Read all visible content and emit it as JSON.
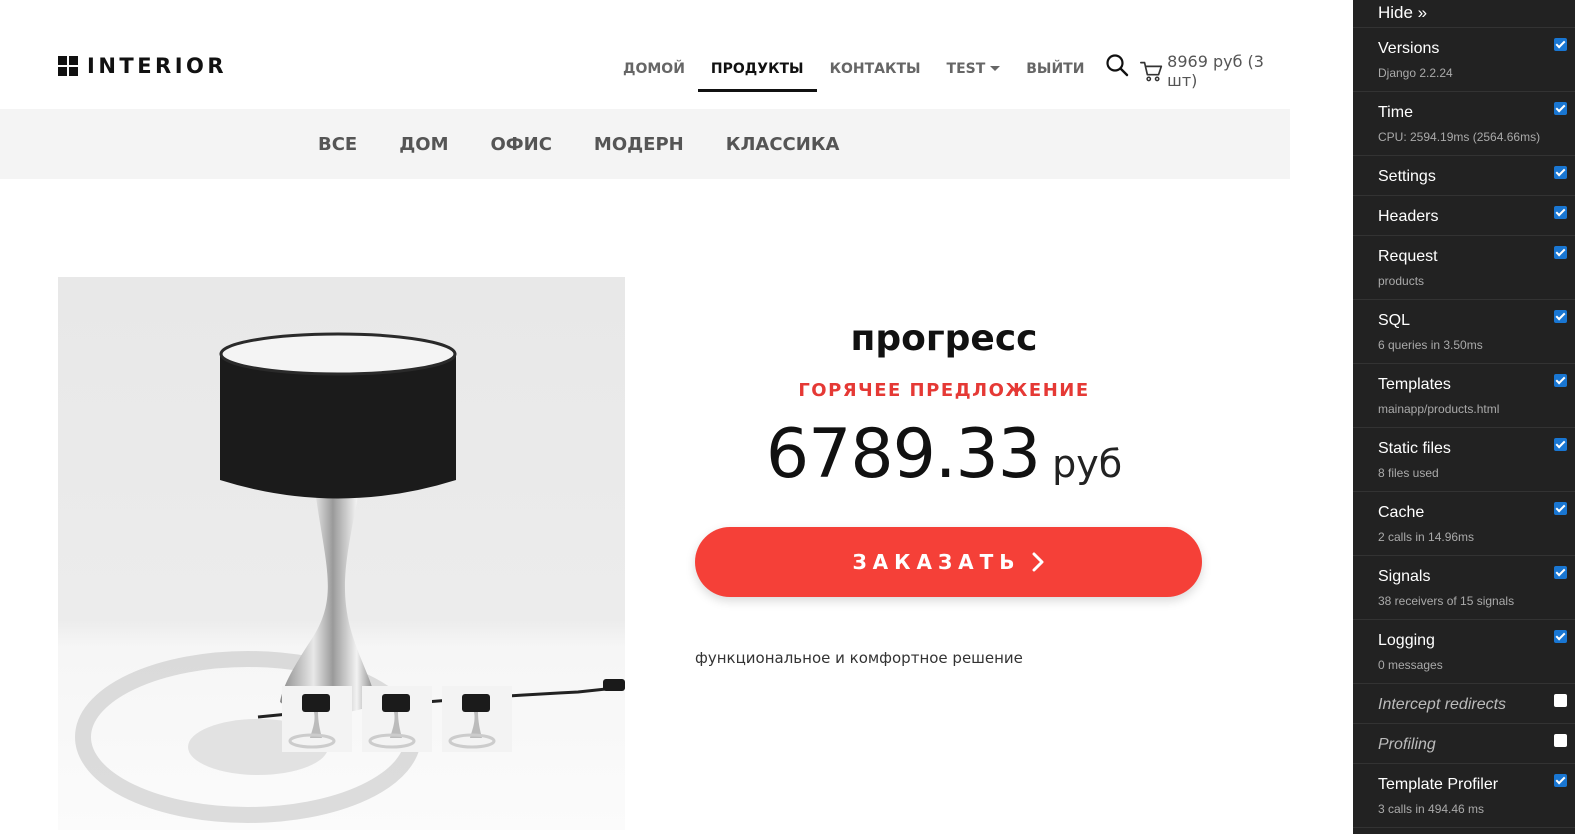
{
  "header": {
    "logo_text": "INTERIOR",
    "nav": [
      {
        "label": "ДОМОЙ"
      },
      {
        "label": "ПРОДУКТЫ"
      },
      {
        "label": "КОНТАКТЫ"
      },
      {
        "label": "TEST"
      },
      {
        "label": "ВЫЙТИ"
      }
    ],
    "active_nav": "ПРОДУКТЫ",
    "cart_text": "8969 руб (3 шт)"
  },
  "categories": [
    "ВСЕ",
    "ДОМ",
    "ОФИС",
    "МОДЕРН",
    "КЛАССИКА"
  ],
  "product": {
    "title": "прогресс",
    "offer": "ГОРЯЧЕЕ ПРЕДЛОЖЕНИЕ",
    "price": "6789.33",
    "currency": "руб",
    "order_label": "ЗАКАЗАТЬ",
    "description": "функциональное и комфортное решение",
    "thumbnail_count": 3
  },
  "colors": {
    "accent_red": "#f54038",
    "offer_red": "#e53935",
    "toolbar_bg": "#222222",
    "checkbox_blue": "#1976d2"
  },
  "debug_toolbar": {
    "hide_label": "Hide »",
    "panels": [
      {
        "title": "Versions",
        "subtitle": "Django 2.2.24",
        "checked": true
      },
      {
        "title": "Time",
        "subtitle": "CPU: 2594.19ms (2564.66ms)",
        "checked": true
      },
      {
        "title": "Settings",
        "subtitle": "",
        "checked": true
      },
      {
        "title": "Headers",
        "subtitle": "",
        "checked": true
      },
      {
        "title": "Request",
        "subtitle": "products",
        "checked": true
      },
      {
        "title": "SQL",
        "subtitle": "6 queries in 3.50ms",
        "checked": true
      },
      {
        "title": "Templates",
        "subtitle": "mainapp/products.html",
        "checked": true
      },
      {
        "title": "Static files",
        "subtitle": "8 files used",
        "checked": true
      },
      {
        "title": "Cache",
        "subtitle": "2 calls in 14.96ms",
        "checked": true
      },
      {
        "title": "Signals",
        "subtitle": "38 receivers of 15 signals",
        "checked": true
      },
      {
        "title": "Logging",
        "subtitle": "0 messages",
        "checked": true
      },
      {
        "title": "Intercept redirects",
        "subtitle": "",
        "checked": false
      },
      {
        "title": "Profiling",
        "subtitle": "",
        "checked": false
      },
      {
        "title": "Template Profiler",
        "subtitle": "3 calls in 494.46 ms",
        "checked": true
      }
    ]
  }
}
